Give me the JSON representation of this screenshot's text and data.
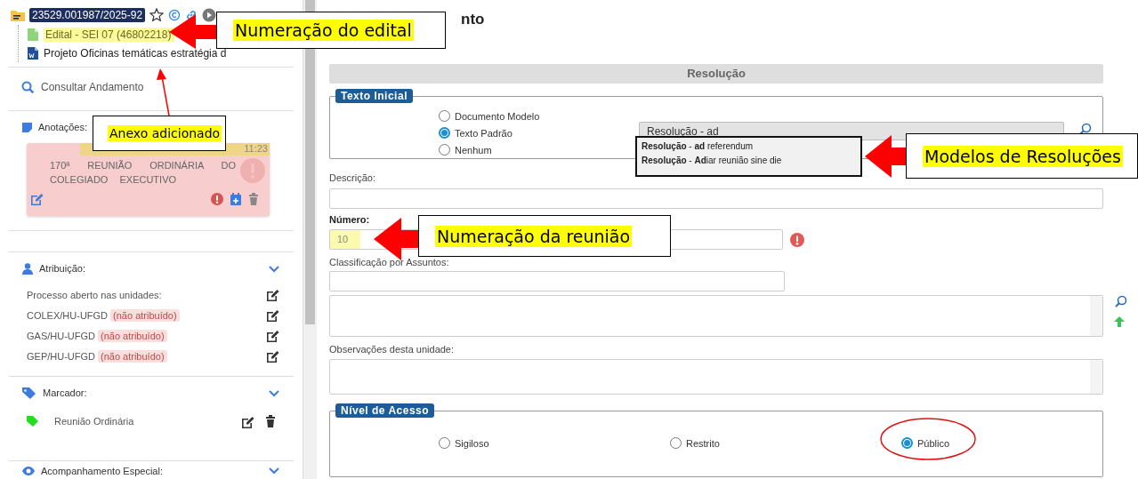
{
  "process": {
    "number": "23529.001987/2025-92"
  },
  "tree": [
    {
      "kind": "pdf",
      "label": "Edital - SEI 07 (46802218)",
      "highlighted": true
    },
    {
      "kind": "word",
      "label": "Projeto Oficinas temáticas estratégia d",
      "highlighted": false
    }
  ],
  "consult_link": "Consultar Andamento",
  "annotations": {
    "title": "Anotações:",
    "note": {
      "time": "11:23",
      "text": "170ª REUNIÃO ORDINÁRIA DO COLEGIADO EXECUTIVO"
    }
  },
  "attribution": {
    "title": "Atribuição:",
    "intro": "Processo aberto nas unidades:",
    "units": [
      {
        "name": "COLEX/HU-UFGD",
        "status": "(não atribuído)"
      },
      {
        "name": "GAS/HU-UFGD",
        "status": "(não atribuído)"
      },
      {
        "name": "GEP/HU-UFGD",
        "status": "(não atribuído)"
      }
    ]
  },
  "marker": {
    "title": "Marcador:",
    "items": [
      {
        "label": "Reunião Ordinária",
        "color": "#22dd22"
      }
    ]
  },
  "special_tracking": {
    "title": "Acompanhamento Especial:"
  },
  "main": {
    "heading": "nto",
    "section_title": "Resolução",
    "initial_text": {
      "legend": "Texto Inicial",
      "options": [
        {
          "label": "Documento Modelo",
          "selected": false
        },
        {
          "label": "Texto Padrão",
          "selected": true
        },
        {
          "label": "Nenhum",
          "selected": false
        }
      ],
      "model_value": "Resolução - ad",
      "suggestions": [
        "**Resolução** - **ad** referendum",
        "**Resolução** - **Ad**iar reunião sine die"
      ]
    },
    "description_label": "Descrição:",
    "number": {
      "label": "Número:",
      "value": "10"
    },
    "subjects_label": "Classificação por Assuntos:",
    "notes_label": "Observações desta unidade:",
    "access": {
      "legend": "Nível de Acesso",
      "options": [
        {
          "label": "Sigiloso",
          "selected": false
        },
        {
          "label": "Restrito",
          "selected": false
        },
        {
          "label": "Público",
          "selected": true
        }
      ]
    }
  },
  "callouts": [
    {
      "text": "Numeração do edital"
    },
    {
      "text": "Anexo adicionado"
    },
    {
      "text": "Modelos de Resoluções"
    },
    {
      "text": "Numeração da reunião"
    }
  ]
}
